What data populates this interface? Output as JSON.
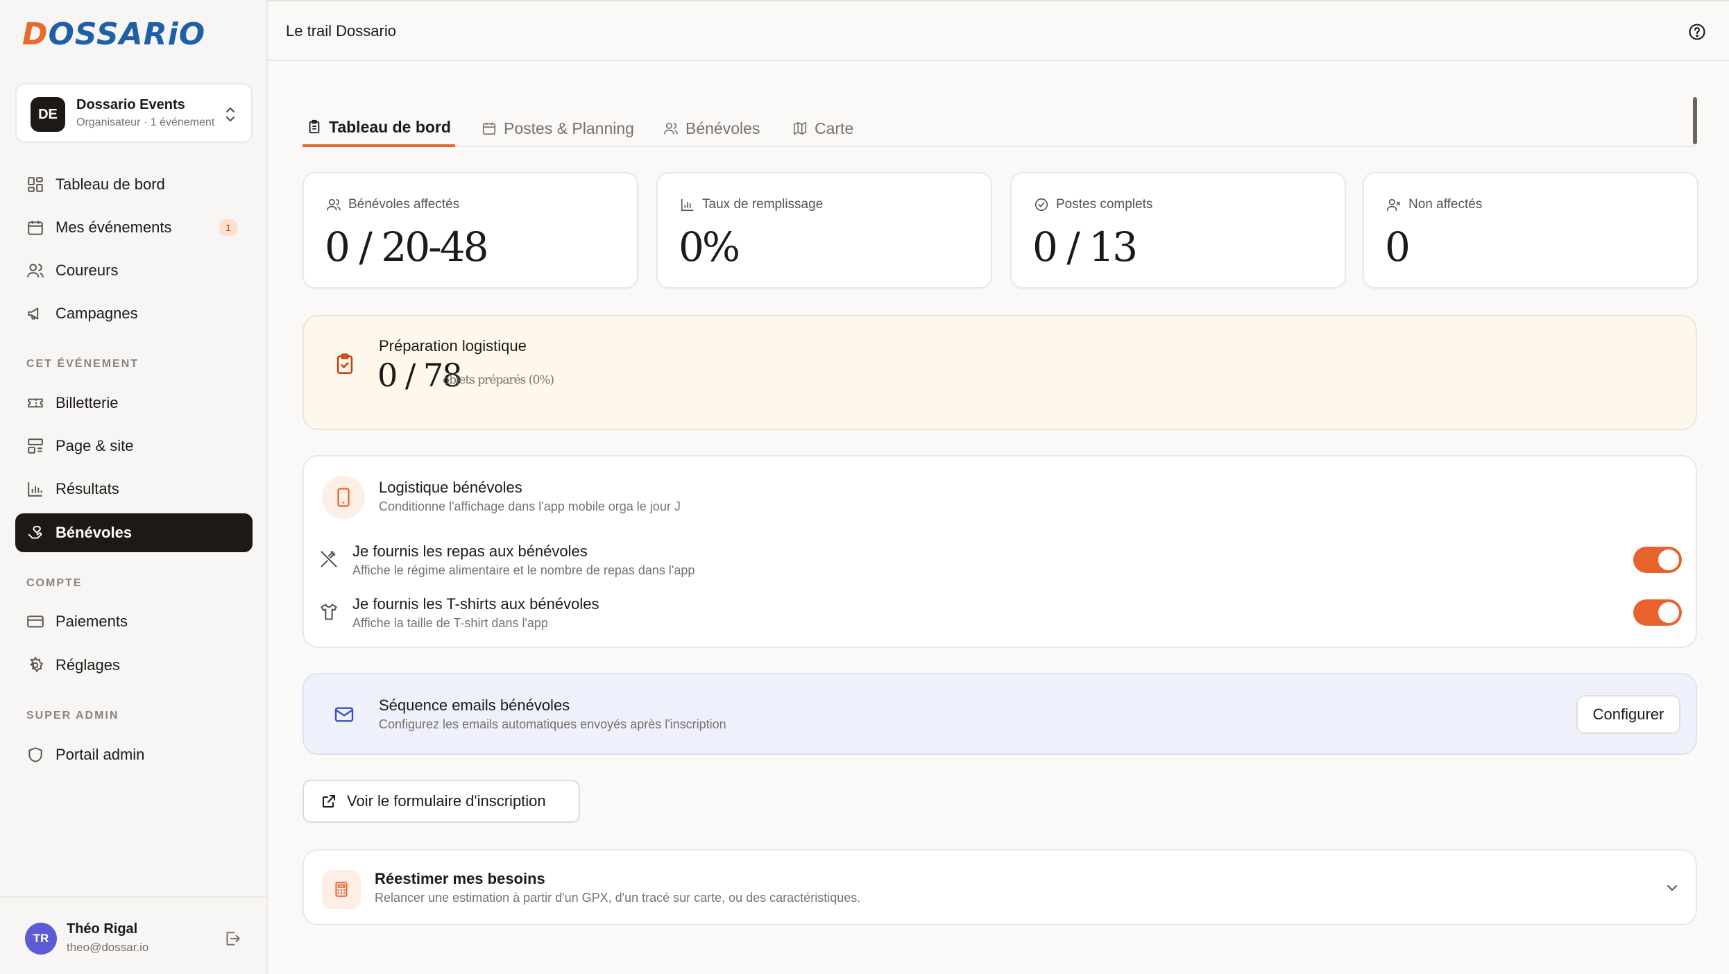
{
  "brand": {
    "logo_text_d": "D",
    "logo_text_rest": "OSSARiO"
  },
  "org": {
    "initials": "DE",
    "name": "Dossario Events",
    "role": "Organisateur · 1 événement"
  },
  "nav": {
    "main": [
      {
        "label": "Tableau de bord",
        "icon": "dashboard-icon"
      },
      {
        "label": "Mes événements",
        "icon": "calendar-icon",
        "badge": "1"
      },
      {
        "label": "Coureurs",
        "icon": "users-icon"
      },
      {
        "label": "Campagnes",
        "icon": "megaphone-icon"
      }
    ],
    "section_event": "CET ÉVÉNEMENT",
    "event": [
      {
        "label": "Billetterie",
        "icon": "ticket-icon"
      },
      {
        "label": "Page & site",
        "icon": "layout-icon"
      },
      {
        "label": "Résultats",
        "icon": "bar-chart-icon"
      },
      {
        "label": "Bénévoles",
        "icon": "hand-heart-icon",
        "active": true
      }
    ],
    "section_account": "COMPTE",
    "account": [
      {
        "label": "Paiements",
        "icon": "credit-card-icon"
      },
      {
        "label": "Réglages",
        "icon": "gear-icon"
      }
    ],
    "section_admin": "SUPER ADMIN",
    "admin": [
      {
        "label": "Portail admin",
        "icon": "shield-icon"
      }
    ]
  },
  "user": {
    "initials": "TR",
    "name": "Théo Rigal",
    "email": "theo@dossar.io"
  },
  "header": {
    "title": "Le trail Dossario"
  },
  "tabs": [
    {
      "label": "Tableau de bord",
      "active": true
    },
    {
      "label": "Postes & Planning"
    },
    {
      "label": "Bénévoles"
    },
    {
      "label": "Carte"
    }
  ],
  "stats": [
    {
      "label": "Bénévoles affectés",
      "value": "0 / 20-48"
    },
    {
      "label": "Taux de remplissage",
      "value": "0%"
    },
    {
      "label": "Postes complets",
      "value": "0 / 13"
    },
    {
      "label": "Non affectés",
      "value": "0"
    }
  ],
  "prep": {
    "title": "Préparation logistique",
    "value": "0 / 78",
    "sub": "objets préparés (0%)"
  },
  "logistics": {
    "title": "Logistique bénévoles",
    "subtitle": "Conditionne l'affichage dans l'app mobile orga le jour J",
    "options": [
      {
        "title": "Je fournis les repas aux bénévoles",
        "subtitle": "Affiche le régime alimentaire et le nombre de repas dans l'app",
        "enabled": true
      },
      {
        "title": "Je fournis les T-shirts aux bénévoles",
        "subtitle": "Affiche la taille de T-shirt dans l'app",
        "enabled": true
      }
    ]
  },
  "email_seq": {
    "title": "Séquence emails bénévoles",
    "subtitle": "Configurez les emails automatiques envoyés après l'inscription",
    "button": "Configurer"
  },
  "form_link": {
    "label": "Voir le formulaire d'inscription"
  },
  "reestimate": {
    "title": "Réestimer mes besoins",
    "subtitle": "Relancer une estimation à partir d'un GPX, d'un tracé sur carte, ou des caractéristiques."
  },
  "colors": {
    "accent": "#e8632c",
    "dark": "#1c1917",
    "prep_bg": "#fef8ec",
    "email_bg": "#eef0fb",
    "logo_blue": "#1f5fa8"
  }
}
